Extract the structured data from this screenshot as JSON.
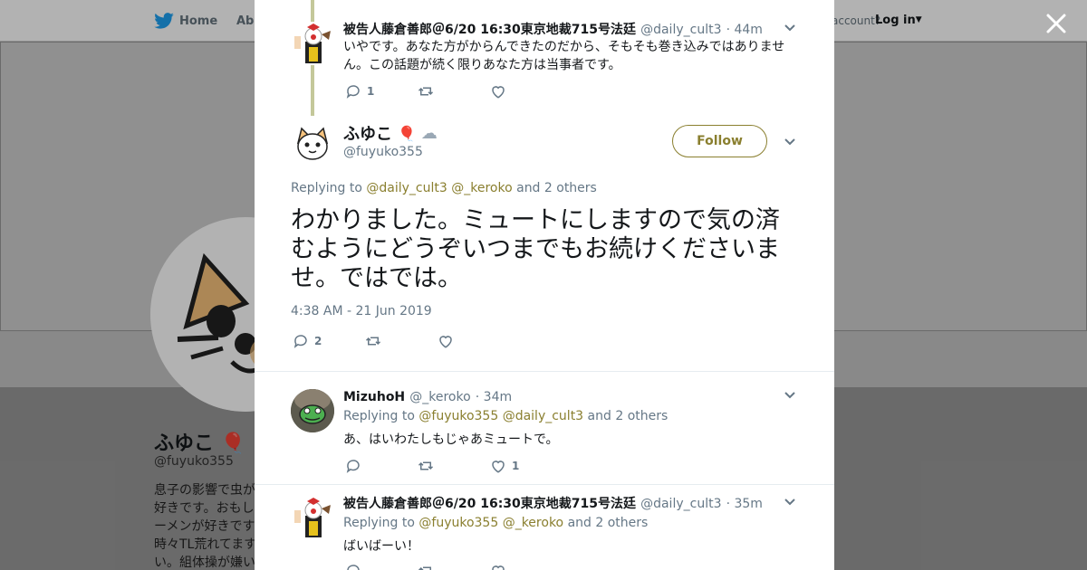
{
  "background": {
    "nav": {
      "home": "Home",
      "about": "Abo",
      "account": "account?",
      "login": "Log in"
    },
    "profile": {
      "name": "ふゆこ",
      "handle": "@fuyuko355",
      "bio_lines": [
        "息子の影響で虫が",
        "好きです。おもし",
        "ーメンが好きです",
        "時々TL荒れてます",
        "い。組体操が嫌い"
      ]
    }
  },
  "close_icon": "close-icon",
  "thread": {
    "parent": {
      "name": "被告人藤倉善郎＠6/20 16:30東京地裁715号法廷",
      "handle": "@daily_cult3",
      "time": "· 44m",
      "text": "いやです。あなた方がからんできたのだから、そもそも巻き込みではありません。この話題が続く限りあなた方は当事者です。",
      "replies": "1",
      "retweets": "",
      "likes": ""
    },
    "main": {
      "name": "ふゆこ",
      "handle": "@fuyuko355",
      "follow_label": "Follow",
      "replying_prefix": "Replying to",
      "replying_users": [
        "@daily_cult3",
        "@_keroko"
      ],
      "replying_suffix": "and 2 others",
      "text": "わかりました。ミュートにしますので気の済むようにどうぞいつまでもお続けくださいませ。ではでは。",
      "timestamp": "4:38 AM - 21 Jun 2019",
      "replies": "2",
      "retweets": "",
      "likes": ""
    },
    "reply1": {
      "name": "MizuhoH",
      "handle": "@_keroko",
      "time": "· 34m",
      "replying_prefix": "Replying to",
      "replying_users": [
        "@fuyuko355",
        "@daily_cult3"
      ],
      "replying_suffix": "and 2 others",
      "text": "あ、はいわたしもじゃあミュートで。",
      "replies": "",
      "retweets": "",
      "likes": "1"
    },
    "reply2": {
      "name": "被告人藤倉善郎＠6/20 16:30東京地裁715号法廷",
      "handle": "@daily_cult3",
      "time": "· 35m",
      "replying_prefix": "Replying to",
      "replying_users": [
        "@fuyuko355",
        "@_keroko"
      ],
      "replying_suffix": "and 2 others",
      "text": "ばいばーい！"
    }
  },
  "colors": {
    "accent": "#8a7f2f",
    "thread_line": "#c4c89a",
    "twitter_blue": "#1da1f2"
  }
}
